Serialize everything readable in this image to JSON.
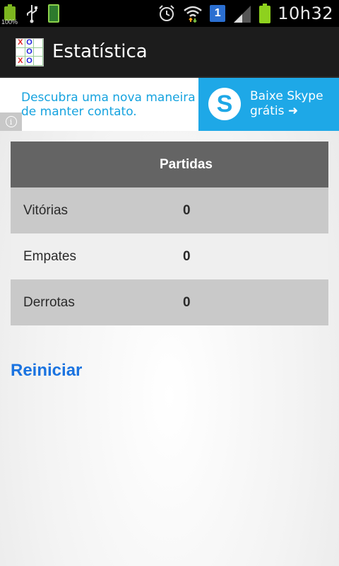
{
  "status_bar": {
    "battery_small_text": "100%",
    "time": "10h32",
    "notification_badge": "1",
    "icons": [
      "battery-small-icon",
      "usb-icon",
      "sim-icon",
      "alarm-icon",
      "wifi-icon",
      "notification-badge-icon",
      "signal-icon",
      "battery-icon"
    ]
  },
  "action_bar": {
    "title": "Estatística",
    "app_icon_cells": [
      "X",
      "O",
      "",
      "",
      "O",
      "",
      "X",
      "O",
      ""
    ]
  },
  "ad": {
    "left_text_line1": "Descubra uma nova maneira",
    "left_text_line2": "de manter contato.",
    "right_text_line1": "Baixe Skype",
    "right_text_line2": "grátis ➜",
    "logo_letter": "S",
    "info_glyph": "i"
  },
  "stats": {
    "column_header": "Partidas",
    "rows": [
      {
        "label": "Vitórias",
        "value": "0"
      },
      {
        "label": "Empates",
        "value": "0"
      },
      {
        "label": "Derrotas",
        "value": "0"
      }
    ]
  },
  "reset_label": "Reiniciar",
  "colors": {
    "accent_link": "#1a73e0",
    "ad_blue": "#1ea8e7",
    "header_gray": "#646464"
  }
}
